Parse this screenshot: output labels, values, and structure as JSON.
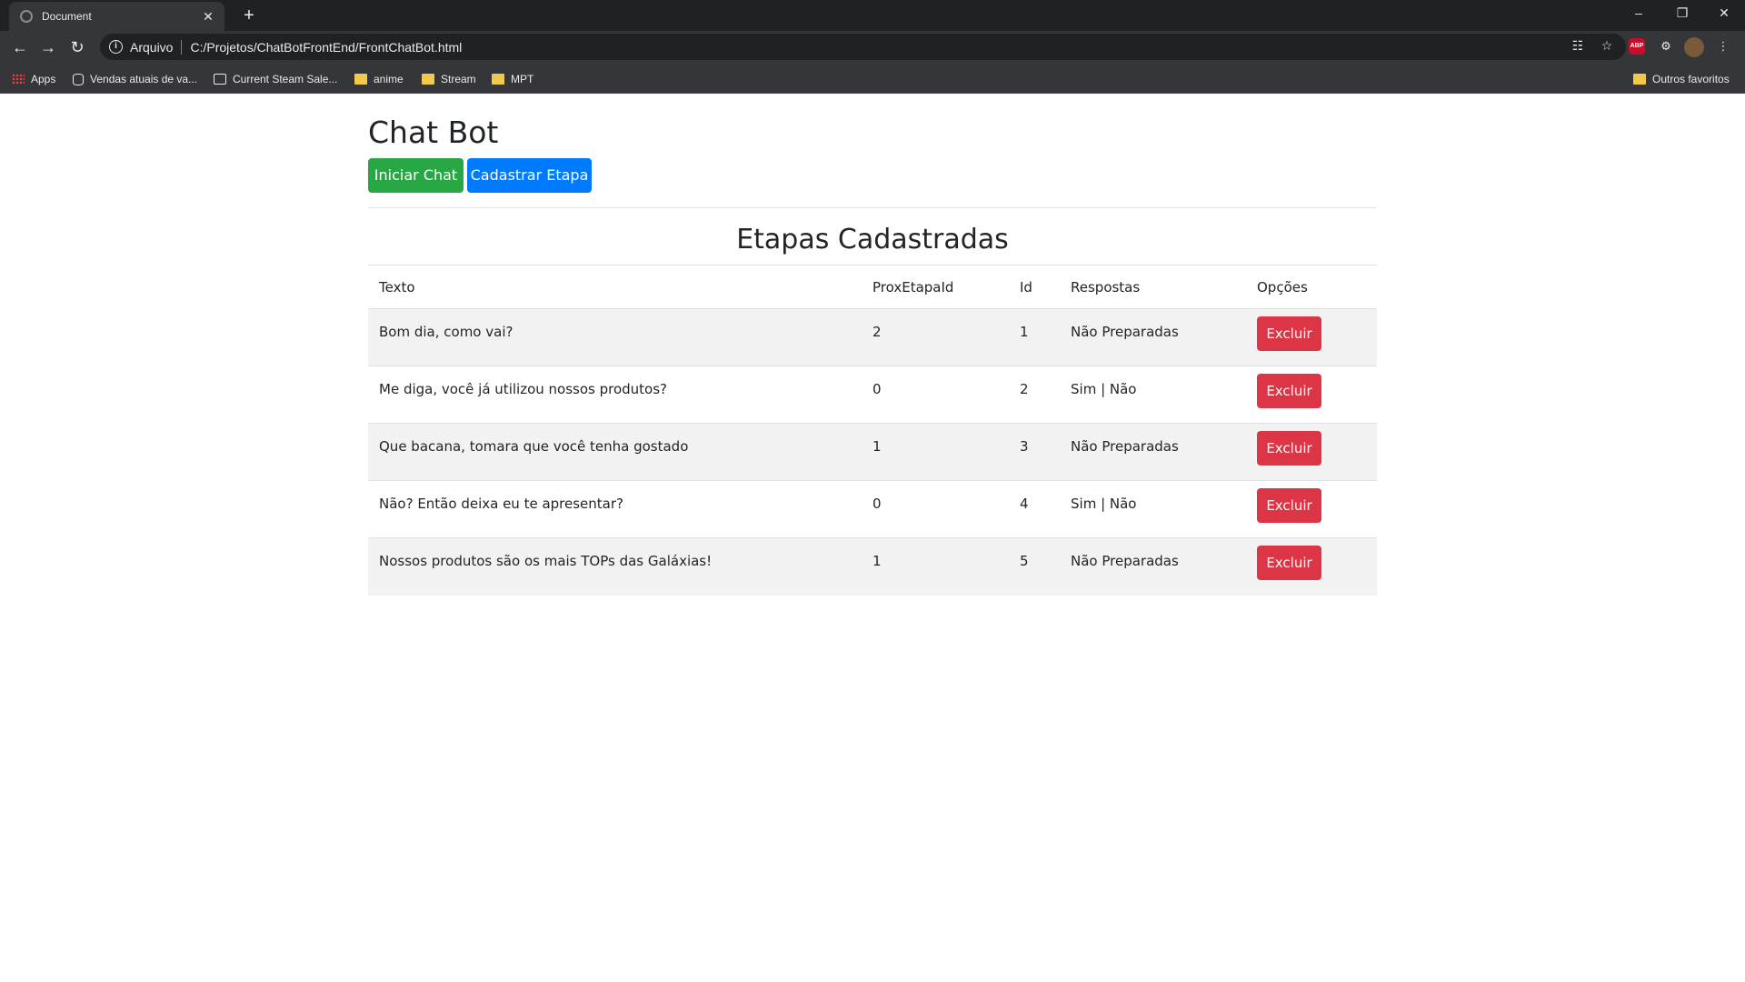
{
  "browser": {
    "tab_title": "Document",
    "scheme_label": "Arquivo",
    "url": "C:/Projetos/ChatBotFrontEnd/FrontChatBot.html",
    "bookmarks": [
      {
        "label": "Apps",
        "icon": "apps-grid-icon"
      },
      {
        "label": "Vendas atuais de va...",
        "icon": "database-icon"
      },
      {
        "label": "Current Steam Sale...",
        "icon": "page-icon"
      },
      {
        "label": "anime",
        "icon": "folder-icon"
      },
      {
        "label": "Stream",
        "icon": "folder-icon"
      },
      {
        "label": "MPT",
        "icon": "folder-icon"
      }
    ],
    "other_bookmarks": "Outros favoritos",
    "extension_abp_label": "ABP"
  },
  "header": {
    "title": "Chat Bot",
    "start_chat_label": "Iniciar Chat",
    "register_step_label": "Cadastrar Etapa"
  },
  "section": {
    "title": "Etapas Cadastradas"
  },
  "table": {
    "columns": [
      "Texto",
      "ProxEtapaId",
      "Id",
      "Respostas",
      "Opções"
    ],
    "rows": [
      {
        "texto": "Bom dia, como vai?",
        "prox": "2",
        "id": "1",
        "respostas": "Não Preparadas",
        "action": "Excluir"
      },
      {
        "texto": "Me diga, você já utilizou nossos produtos?",
        "prox": "0",
        "id": "2",
        "respostas": "Sim | Não",
        "action": "Excluir"
      },
      {
        "texto": "Que bacana, tomara que você tenha gostado",
        "prox": "1",
        "id": "3",
        "respostas": "Não Preparadas",
        "action": "Excluir"
      },
      {
        "texto": "Não? Então deixa eu te apresentar?",
        "prox": "0",
        "id": "4",
        "respostas": "Sim | Não",
        "action": "Excluir"
      },
      {
        "texto": "Nossos produtos são os mais TOPs das Galáxias!",
        "prox": "1",
        "id": "5",
        "respostas": "Não Preparadas",
        "action": "Excluir"
      }
    ]
  },
  "colors": {
    "success": "#28a745",
    "primary": "#007bff",
    "danger": "#dc3545"
  }
}
